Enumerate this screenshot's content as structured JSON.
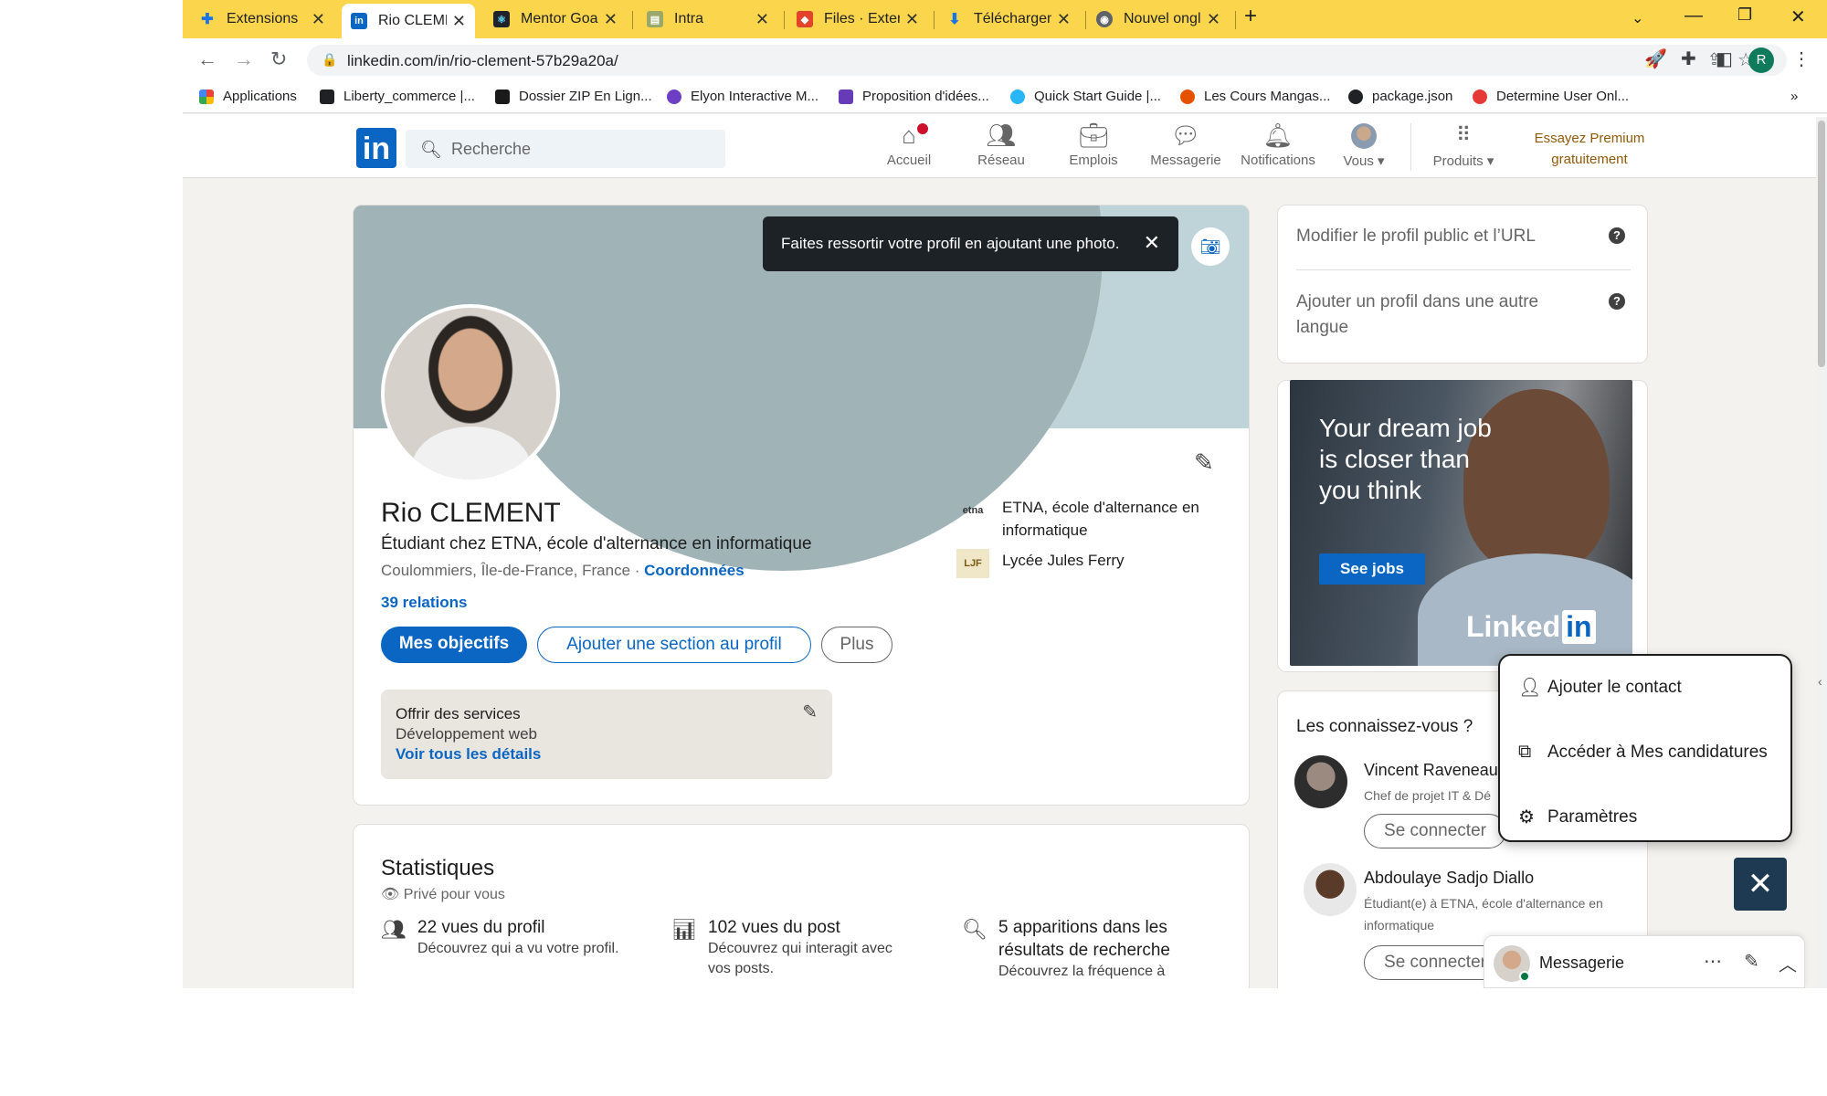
{
  "browser": {
    "tabs": [
      {
        "title": "Extensions",
        "color": "#1a73e8",
        "glyph": "✚"
      },
      {
        "title": "Rio CLEMENT | LinkedIn",
        "color": "#0a66c2",
        "glyph": "in"
      },
      {
        "title": "Mentor Goal",
        "color": "#20232a",
        "glyph": "⚛"
      },
      {
        "title": "Intra",
        "color": "#6b8e23",
        "glyph": "▤"
      },
      {
        "title": "Files · Extension+ ·",
        "color": "#e24329",
        "glyph": "🦊"
      },
      {
        "title": "Téléchargements",
        "color": "#1a73e8",
        "glyph": "⬇"
      },
      {
        "title": "Nouvel onglet",
        "color": "#5f6368",
        "glyph": "◉"
      }
    ],
    "url": "linkedin.com/in/rio-clement-57b29a20a/",
    "profile_initial": "R",
    "bookmarks": [
      {
        "label": "Applications",
        "color": "#ea4335"
      },
      {
        "label": "Liberty_commerce |...",
        "color": "#202124"
      },
      {
        "label": "Dossier ZIP En Lign...",
        "color": "#1a1a1a"
      },
      {
        "label": "Elyon Interactive M...",
        "color": "#6c3fc5"
      },
      {
        "label": "Proposition d'idées...",
        "color": "#673ab7"
      },
      {
        "label": "Quick Start Guide |...",
        "color": "#29b6f6"
      },
      {
        "label": "Les Cours Mangas...",
        "color": "#e65100"
      },
      {
        "label": "package.json",
        "color": "#202124"
      },
      {
        "label": "Determine User Onl...",
        "color": "#e53935"
      }
    ],
    "bookmarks_more": "»"
  },
  "header": {
    "logo": "in",
    "search_placeholder": "Recherche",
    "nav": {
      "home": "Accueil",
      "network": "Réseau",
      "jobs": "Emplois",
      "messaging": "Messagerie",
      "notifications": "Notifications",
      "me": "Vous",
      "products": "Produits"
    },
    "premium_line1": "Essayez Premium",
    "premium_line2": "gratuitement"
  },
  "profile": {
    "toast": "Faites ressortir votre profil en ajoutant une photo.",
    "name": "Rio CLEMENT",
    "headline": "Étudiant chez ETNA, école d'alternance en informatique",
    "location": "Coulommiers, Île-de-France, France · ",
    "contact_link": "Coordonnées",
    "relations": "39 relations",
    "btn_goals": "Mes objectifs",
    "btn_add_section": "Ajouter une section au profil",
    "btn_more": "Plus",
    "education": [
      {
        "logo": "etna",
        "name": "ETNA, école d'alternance en",
        "name2": "informatique"
      },
      {
        "logo": "LJF",
        "name": "Lycée Jules Ferry",
        "name2": ""
      }
    ],
    "services_title": "Offrir des services",
    "services_desc": "Développement web",
    "services_link": "Voir tous les détails"
  },
  "stats": {
    "title": "Statistiques",
    "private": "Privé pour vous",
    "items": [
      {
        "title": "22 vues du profil",
        "sub1": "Découvrez qui a vu votre profil.",
        "sub2": ""
      },
      {
        "title": "102 vues du post",
        "sub1": "Découvrez qui interagit avec",
        "sub2": "vos posts."
      },
      {
        "title": "5 apparitions dans les",
        "title2": "résultats de recherche",
        "sub1": "Découvrez la fréquence à",
        "sub2": ""
      }
    ]
  },
  "right": {
    "link1": "Modifier le profil public et l’URL",
    "link2_line1": "Ajouter un profil dans une autre",
    "link2_line2": "langue",
    "ad_text": "Your dream job is closer than you think",
    "ad_button": "See jobs",
    "ad_brand": "Linked",
    "ad_brand_in": "in",
    "pymk_title": "Les connaissez-vous ?",
    "people": [
      {
        "name": "Vincent Raveneau",
        "sub1": "Chef de projet IT & Dé",
        "sub2": "",
        "connect": "Se connecter"
      },
      {
        "name": "Abdoulaye Sadjo Diallo",
        "sub1": "Étudiant(e) à ETNA, école d'alternance en",
        "sub2": "informatique",
        "connect": "Se connecter"
      }
    ]
  },
  "dropdown": {
    "items": [
      {
        "label": "Ajouter le contact",
        "icon": "person-icon"
      },
      {
        "label": "Accéder à Mes candidatures",
        "icon": "external-link-icon"
      },
      {
        "label": "Paramètres",
        "icon": "gear-icon"
      }
    ]
  },
  "messaging_bar": {
    "label": "Messagerie"
  }
}
